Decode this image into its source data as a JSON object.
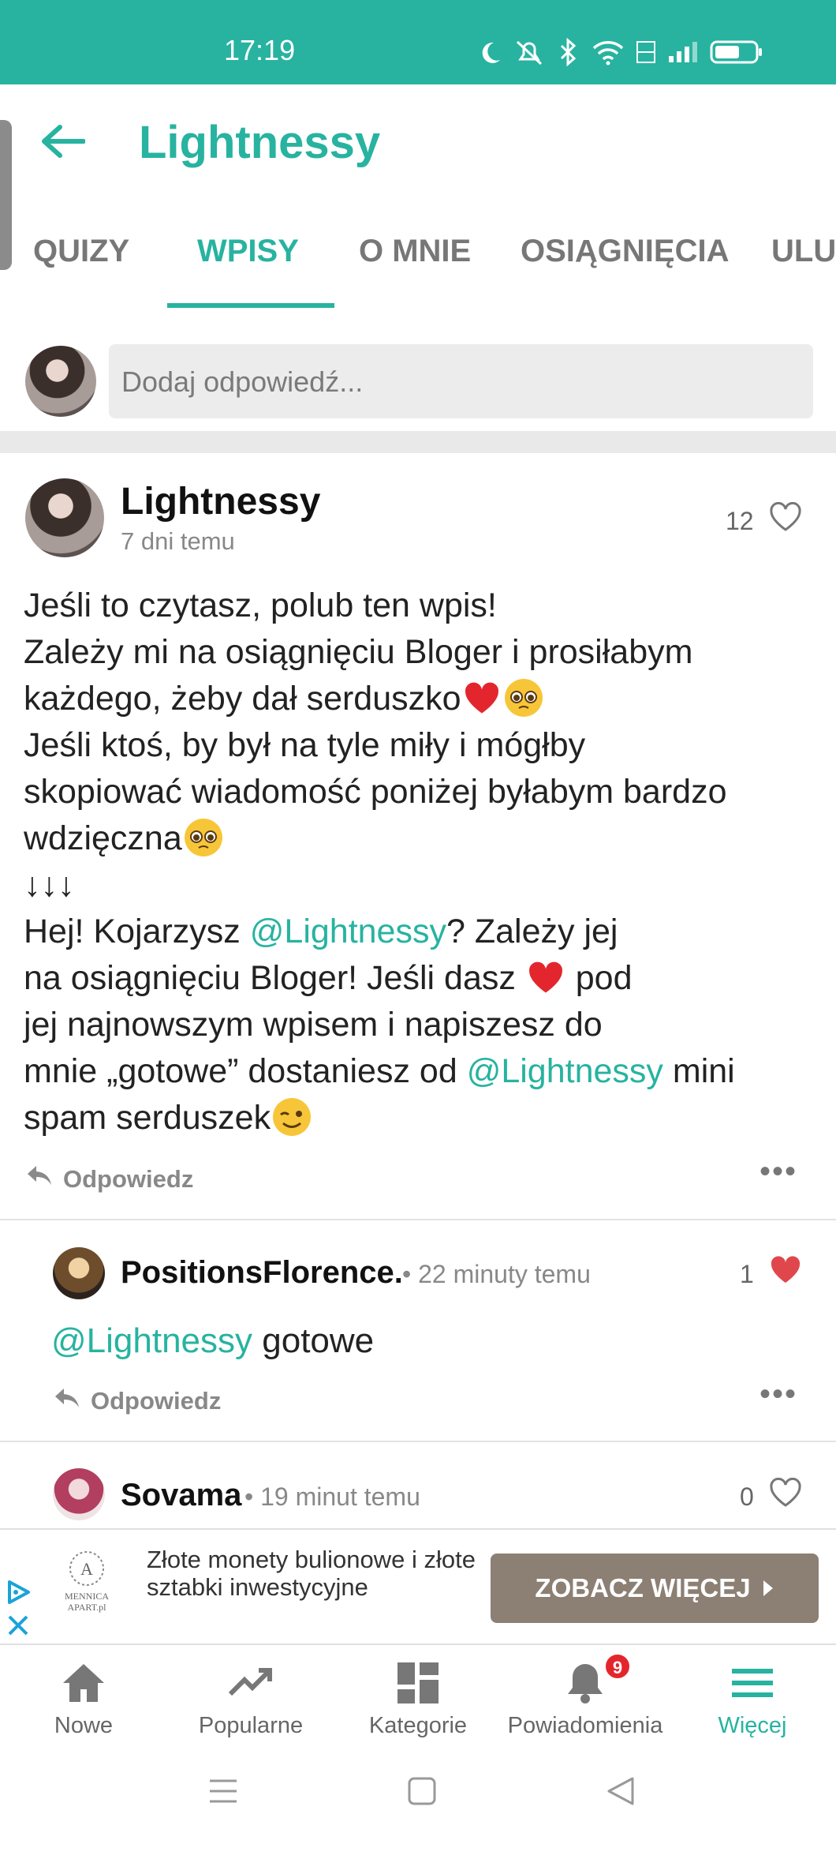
{
  "status_bar": {
    "time": "17:19"
  },
  "header": {
    "title": "Lightnessy"
  },
  "tabs": [
    {
      "label": "QUIZY"
    },
    {
      "label": "WPISY"
    },
    {
      "label": "O MNIE"
    },
    {
      "label": "OSIĄGNIĘCIA"
    },
    {
      "label": "ULU"
    }
  ],
  "reply_bar": {
    "placeholder": "Dodaj odpowiedź..."
  },
  "post": {
    "author": "Lightnessy",
    "date": "7 dni temu",
    "likes": "12",
    "lines": [
      "Jeśli to czytasz, polub ten wpis!",
      "Zależy mi na osiągnięciu Bloger i prosiłabym",
      "każdego, żeby dał serduszko",
      "Jeśli ktoś, by był na tyle miły i mógłby",
      "skopiować wiadomość poniżej byłabym bardzo",
      "wdzięczna",
      "↓↓↓",
      "Hej! Kojarzysz ",
      "? Zależy jej",
      "na osiągnięciu Bloger! Jeśli dasz ",
      " pod",
      "jej najnowszym wpisem i napiszesz do",
      "mnie „gotowe” dostaniesz od ",
      " mini",
      "spam serduszek"
    ],
    "mention": "@Lightnessy",
    "reply_label": "Odpowiedz"
  },
  "comments": [
    {
      "author": "PositionsFlorence.",
      "time": "22 minuty temu",
      "likes": "1",
      "mention": "@Lightnessy",
      "text": " gotowe",
      "reply_label": "Odpowiedz",
      "liked": true
    },
    {
      "author": "Sovama",
      "time": "19 minut temu",
      "likes": "0",
      "liked": false
    }
  ],
  "ad": {
    "text": "Złote monety bulionowe i złote sztabki inwestycyjne",
    "button": "ZOBACZ WIĘCEJ",
    "brand": "MENNICA APART.pl",
    "brand_mark": "A"
  },
  "bottom_nav": [
    {
      "label": "Nowe",
      "icon": "home-icon"
    },
    {
      "label": "Popularne",
      "icon": "trending-icon"
    },
    {
      "label": "Kategorie",
      "icon": "grid-icon"
    },
    {
      "label": "Powiadomienia",
      "icon": "bell-icon",
      "badge": "9"
    },
    {
      "label": "Więcej",
      "icon": "menu-icon"
    }
  ],
  "colors": {
    "accent": "#27b3a0",
    "heart": "#e0474c",
    "ad_button": "#8c7f74",
    "badge": "#e4262c"
  }
}
